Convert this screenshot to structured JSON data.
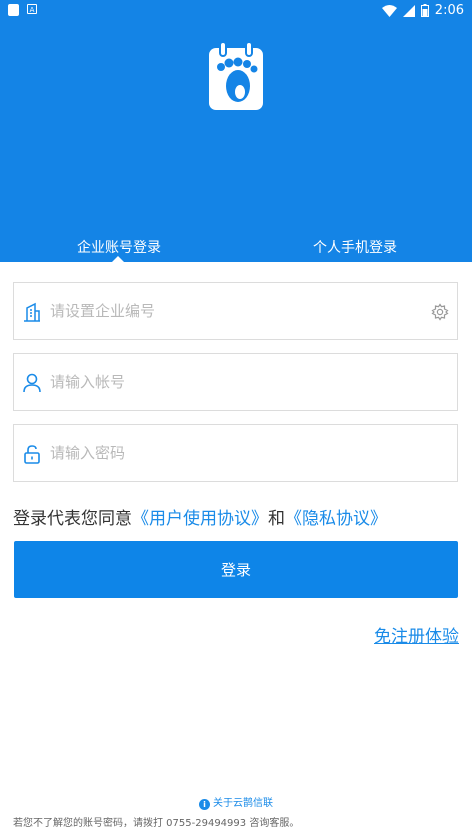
{
  "statusbar": {
    "time": "2:06"
  },
  "tabs": {
    "active": "企业账号登录",
    "other": "个人手机登录"
  },
  "form": {
    "company_placeholder": "请设置企业编号",
    "account_placeholder": "请输入帐号",
    "password_placeholder": "请输入密码"
  },
  "agreement": {
    "prefix": "登录代表您同意",
    "user_agreement": "《用户使用协议》",
    "and": "和",
    "privacy": "《隐私协议》"
  },
  "login_button": "登录",
  "register_link": "免注册体验",
  "about_link": "关于云鹊信联",
  "footer_text": "若您不了解您的账号密码，请拨打 0755-29494993 咨询客服。",
  "colors": {
    "primary": "#1484e6",
    "link": "#1a8be8"
  },
  "icons": [
    "building-icon",
    "user-icon",
    "lock-icon",
    "gear-icon",
    "info-icon",
    "footprint-calendar-icon"
  ]
}
